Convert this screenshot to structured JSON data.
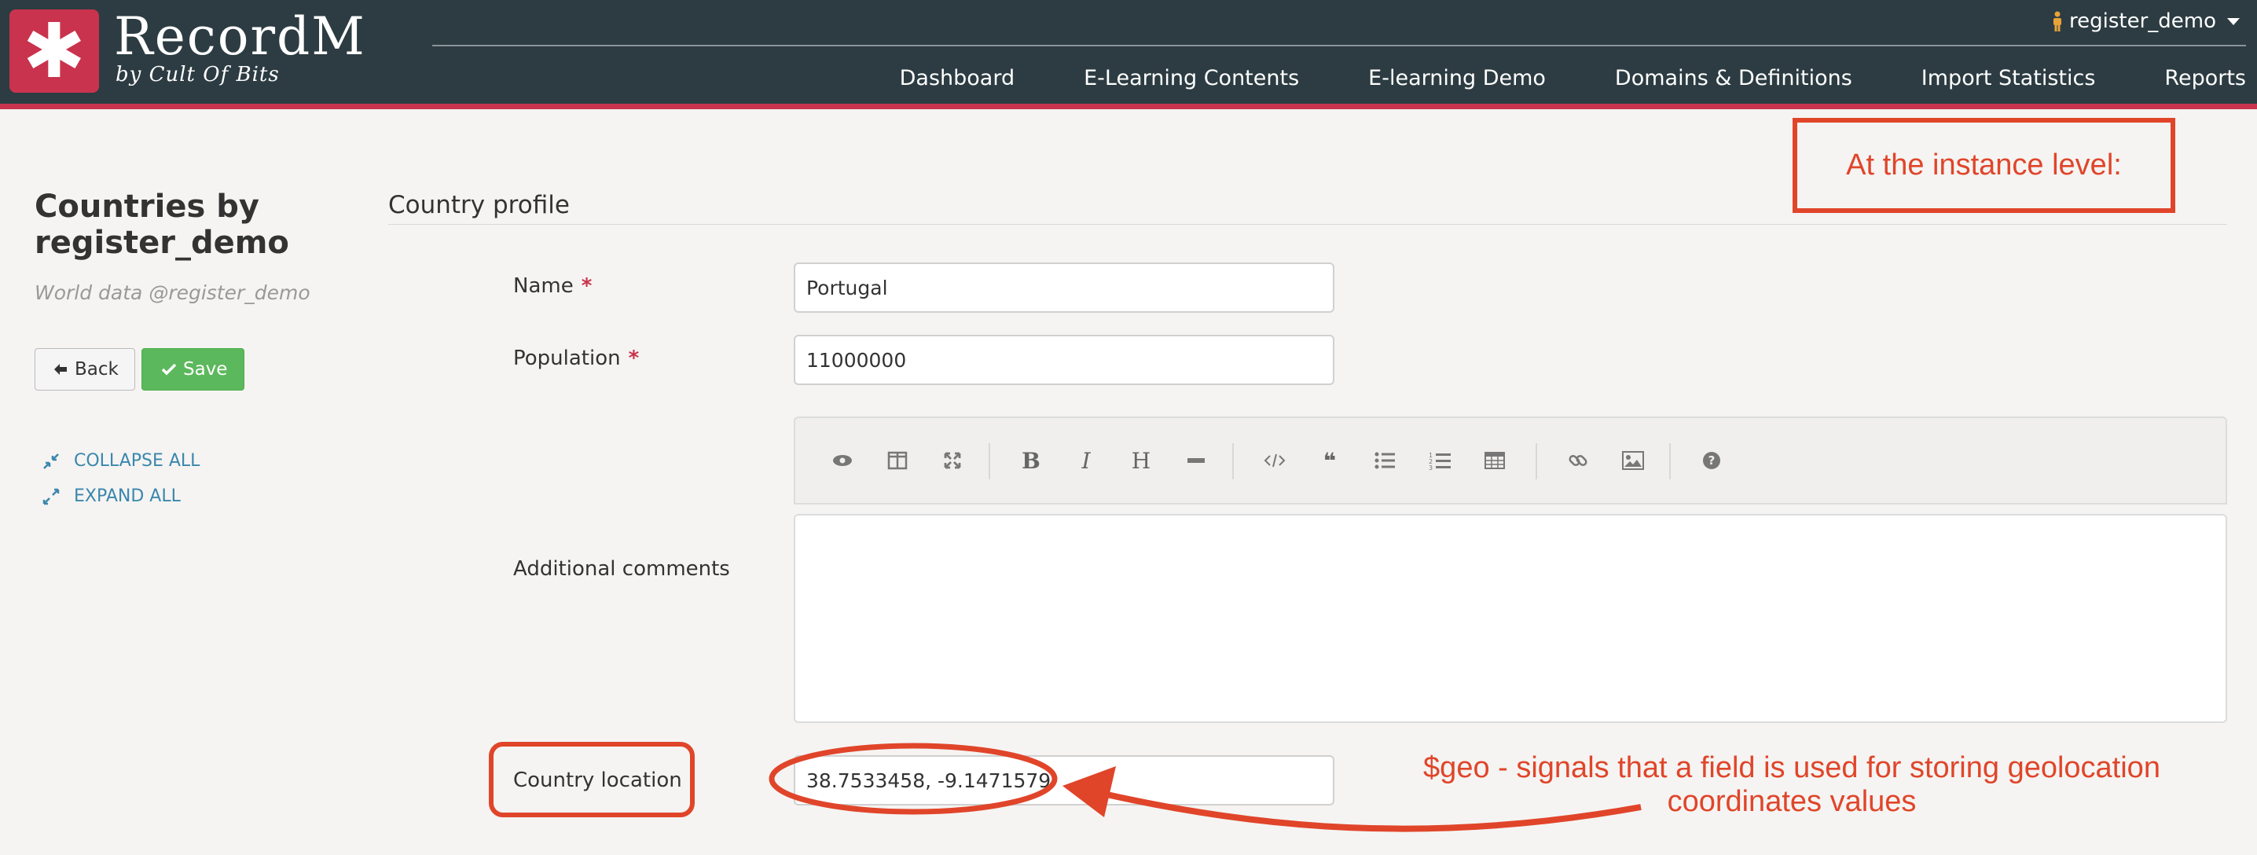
{
  "header": {
    "brand_name": "RecordM",
    "brand_sub": "by Cult Of Bits",
    "logo_glyph": "✱",
    "user": "register_demo",
    "nav": [
      "Dashboard",
      "E-Learning Contents",
      "E-learning Demo",
      "Domains & Definitions",
      "Import Statistics",
      "Reports"
    ]
  },
  "sidebar": {
    "title": "Countries by register_demo",
    "subtitle": "World data @register_demo",
    "back_label": "Back",
    "save_label": "Save",
    "collapse_label": "COLLAPSE ALL",
    "expand_label": "EXPAND ALL"
  },
  "form": {
    "section_title": "Country profile",
    "name_label": "Name",
    "name_value": "Portugal",
    "population_label": "Population",
    "population_value": "11000000",
    "required_mark": "*",
    "comments_label": "Additional comments",
    "location_label": "Country location",
    "location_value": "38.7533458, -9.1471579",
    "toolbar_icons": [
      "preview-icon",
      "side-by-side-icon",
      "fullscreen-icon",
      "bold-icon",
      "italic-icon",
      "heading-icon",
      "horizontal-rule-icon",
      "code-icon",
      "quote-icon",
      "unordered-list-icon",
      "ordered-list-icon",
      "table-icon",
      "link-icon",
      "image-icon",
      "help-icon"
    ]
  },
  "annotations": {
    "instance_level": "At the instance level:",
    "geo_line1": "$geo -  signals that a field is used for storing geolocation",
    "geo_line2": "coordinates values",
    "color": "#e0452a"
  },
  "colors": {
    "topbar": "#2c3c42",
    "accent": "#c9334d",
    "save": "#5cb85c",
    "link": "#3a87ad"
  }
}
